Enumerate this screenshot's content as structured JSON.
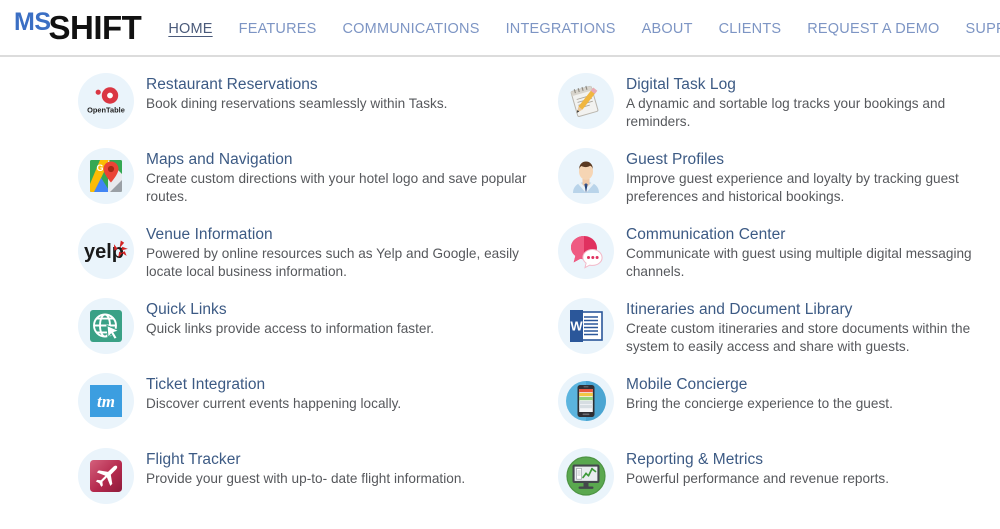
{
  "brand": {
    "logo_prefix": "MS",
    "logo_name": "SHIFT",
    "accent_blue": "#3b6fc4",
    "nav_color": "#7d95c4",
    "title_color": "#3c5a84"
  },
  "nav": {
    "items": [
      {
        "label": "HOME",
        "active": true
      },
      {
        "label": "FEATURES",
        "active": false
      },
      {
        "label": "COMMUNICATIONS",
        "active": false
      },
      {
        "label": "INTEGRATIONS",
        "active": false
      },
      {
        "label": "ABOUT",
        "active": false
      },
      {
        "label": "CLIENTS",
        "active": false
      },
      {
        "label": "REQUEST A DEMO",
        "active": false
      },
      {
        "label": "SUPPORT",
        "active": false
      }
    ]
  },
  "features": {
    "left": [
      {
        "icon": "opentable-icon",
        "title": "Restaurant Reservations",
        "desc": "Book dining reservations seamlessly within Tasks."
      },
      {
        "icon": "google-maps-icon",
        "title": "Maps and Navigation",
        "desc": "Create custom directions with your hotel logo and save popular routes."
      },
      {
        "icon": "yelp-icon",
        "title": "Venue Information",
        "desc": "Powered by online resources such as Yelp and Google, easily locate local business information."
      },
      {
        "icon": "globe-cursor-icon",
        "title": "Quick Links",
        "desc": "Quick links provide access to information faster."
      },
      {
        "icon": "ticketmaster-icon",
        "title": "Ticket Integration",
        "desc": "Discover current events happening locally."
      },
      {
        "icon": "airplane-icon",
        "title": "Flight Tracker",
        "desc": "Provide your guest with up-to- date flight information."
      }
    ],
    "right": [
      {
        "icon": "notepad-pencil-icon",
        "title": "Digital Task Log",
        "desc": "A dynamic and sortable log tracks your bookings and reminders."
      },
      {
        "icon": "guest-avatar-icon",
        "title": "Guest Profiles",
        "desc": "Improve guest experience and loyalty by tracking guest preferences and historical bookings."
      },
      {
        "icon": "chat-bubbles-icon",
        "title": "Communication Center",
        "desc": "Communicate with guest using multiple digital messaging channels."
      },
      {
        "icon": "word-document-icon",
        "title": "Itineraries and Document Library",
        "desc": "Create custom itineraries and store documents within the system to easily access and share with guests."
      },
      {
        "icon": "smartphone-icon",
        "title": "Mobile Concierge",
        "desc": "Bring the concierge experience to the guest."
      },
      {
        "icon": "monitor-chart-icon",
        "title": "Reporting &amp; Metrics",
        "desc": "Powerful performance and revenue reports."
      }
    ]
  }
}
